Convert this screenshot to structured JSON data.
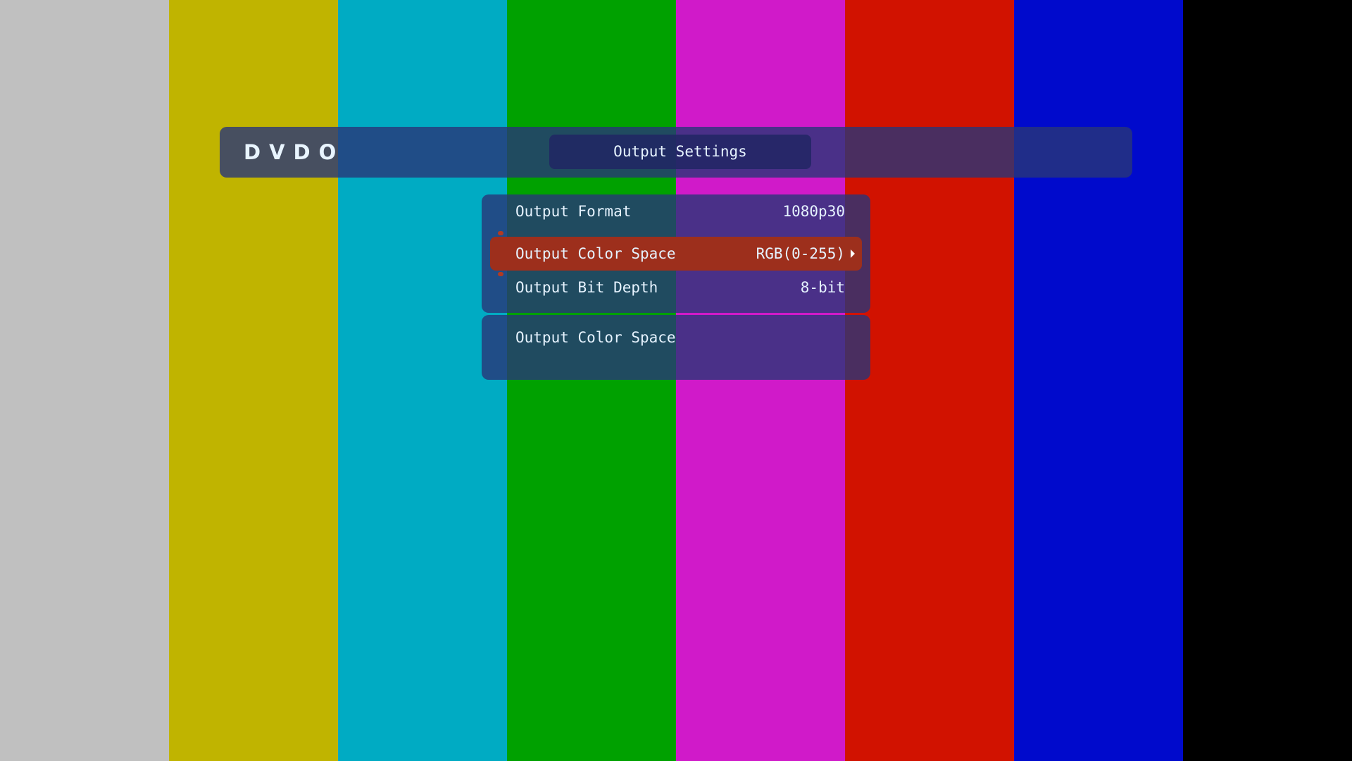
{
  "header": {
    "logo": "DVDO",
    "title": "Output Settings"
  },
  "menu": {
    "items": [
      {
        "label": "Output Format",
        "value": "1080p30",
        "selected": false
      },
      {
        "label": "Output Color Space",
        "value": "RGB(0-255)",
        "selected": true,
        "icon": "chevron-right-icon"
      },
      {
        "label": "Output Bit Depth",
        "value": "8-bit",
        "selected": false
      }
    ]
  },
  "description": {
    "title": "Output Color Space"
  },
  "colors": {
    "test_bars": [
      "#c0c0c0",
      "#c0b400",
      "#00abc3",
      "#00a100",
      "#d01ac9",
      "#d11200",
      "#000acc",
      "#000000"
    ],
    "panel": "#283678",
    "selected_row": "#9d2f1c",
    "text": "#e6f3ff"
  }
}
